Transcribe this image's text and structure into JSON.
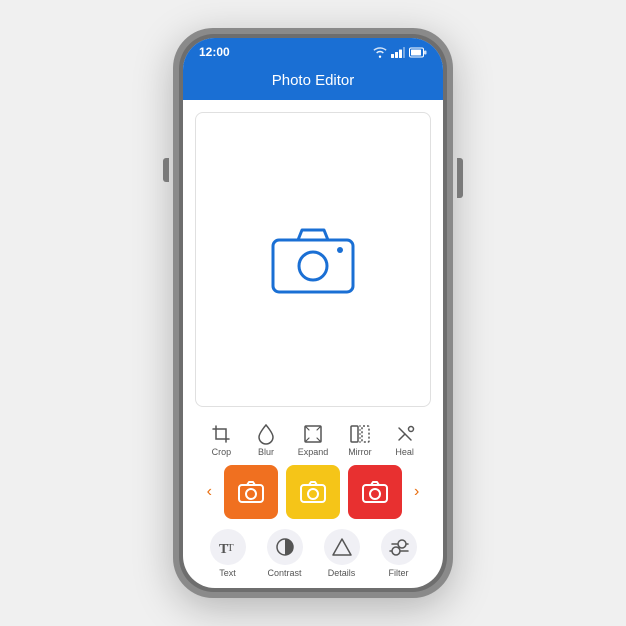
{
  "statusBar": {
    "time": "12:00"
  },
  "header": {
    "title": "Photo Editor"
  },
  "tools": [
    {
      "id": "crop",
      "label": "Crop"
    },
    {
      "id": "blur",
      "label": "Blur"
    },
    {
      "id": "expand",
      "label": "Expand"
    },
    {
      "id": "mirror",
      "label": "Mirror"
    },
    {
      "id": "heal",
      "label": "Heal"
    }
  ],
  "carousel": {
    "leftArrow": "‹",
    "rightArrow": "›",
    "items": [
      {
        "id": "cam-orange",
        "color": "orange"
      },
      {
        "id": "cam-yellow",
        "color": "yellow"
      },
      {
        "id": "cam-red",
        "color": "red"
      }
    ]
  },
  "bottomTools": [
    {
      "id": "text",
      "label": "Text"
    },
    {
      "id": "contrast",
      "label": "Contrast"
    },
    {
      "id": "details",
      "label": "Details"
    },
    {
      "id": "filter",
      "label": "Filter"
    }
  ]
}
